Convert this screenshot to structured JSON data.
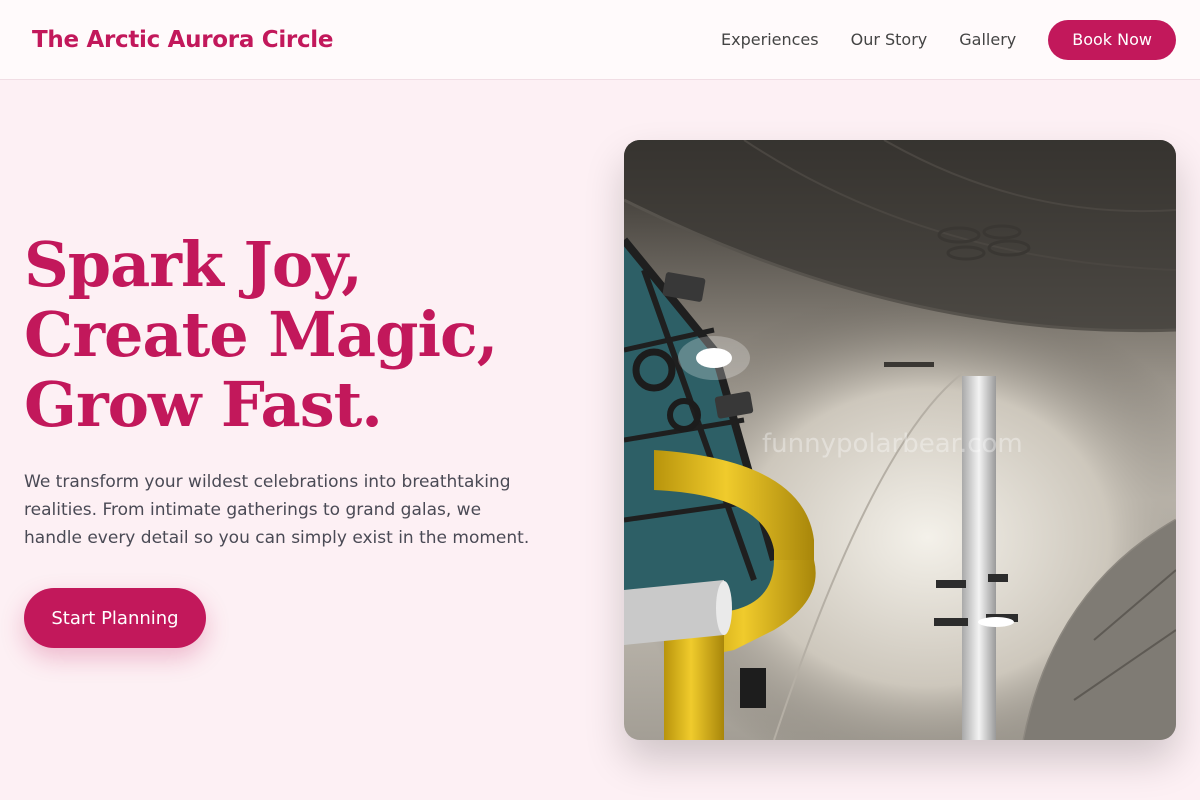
{
  "brand": {
    "name": "The Arctic Aurora Circle"
  },
  "nav": {
    "links": [
      "Experiences",
      "Our Story",
      "Gallery"
    ],
    "cta": "Book Now"
  },
  "hero": {
    "title_lines": [
      "Spark Joy,",
      "Create Magic,",
      "Grow Fast."
    ],
    "description": "We transform your wildest celebrations into breathtaking realities. From intimate gatherings to grand galas, we handle every detail so you can simply exist in the moment.",
    "cta": "Start Planning",
    "image_watermark": "funnypolarbear.com"
  },
  "colors": {
    "accent": "#c2185b",
    "background": "#fdf0f4",
    "text": "#4a4a55"
  }
}
